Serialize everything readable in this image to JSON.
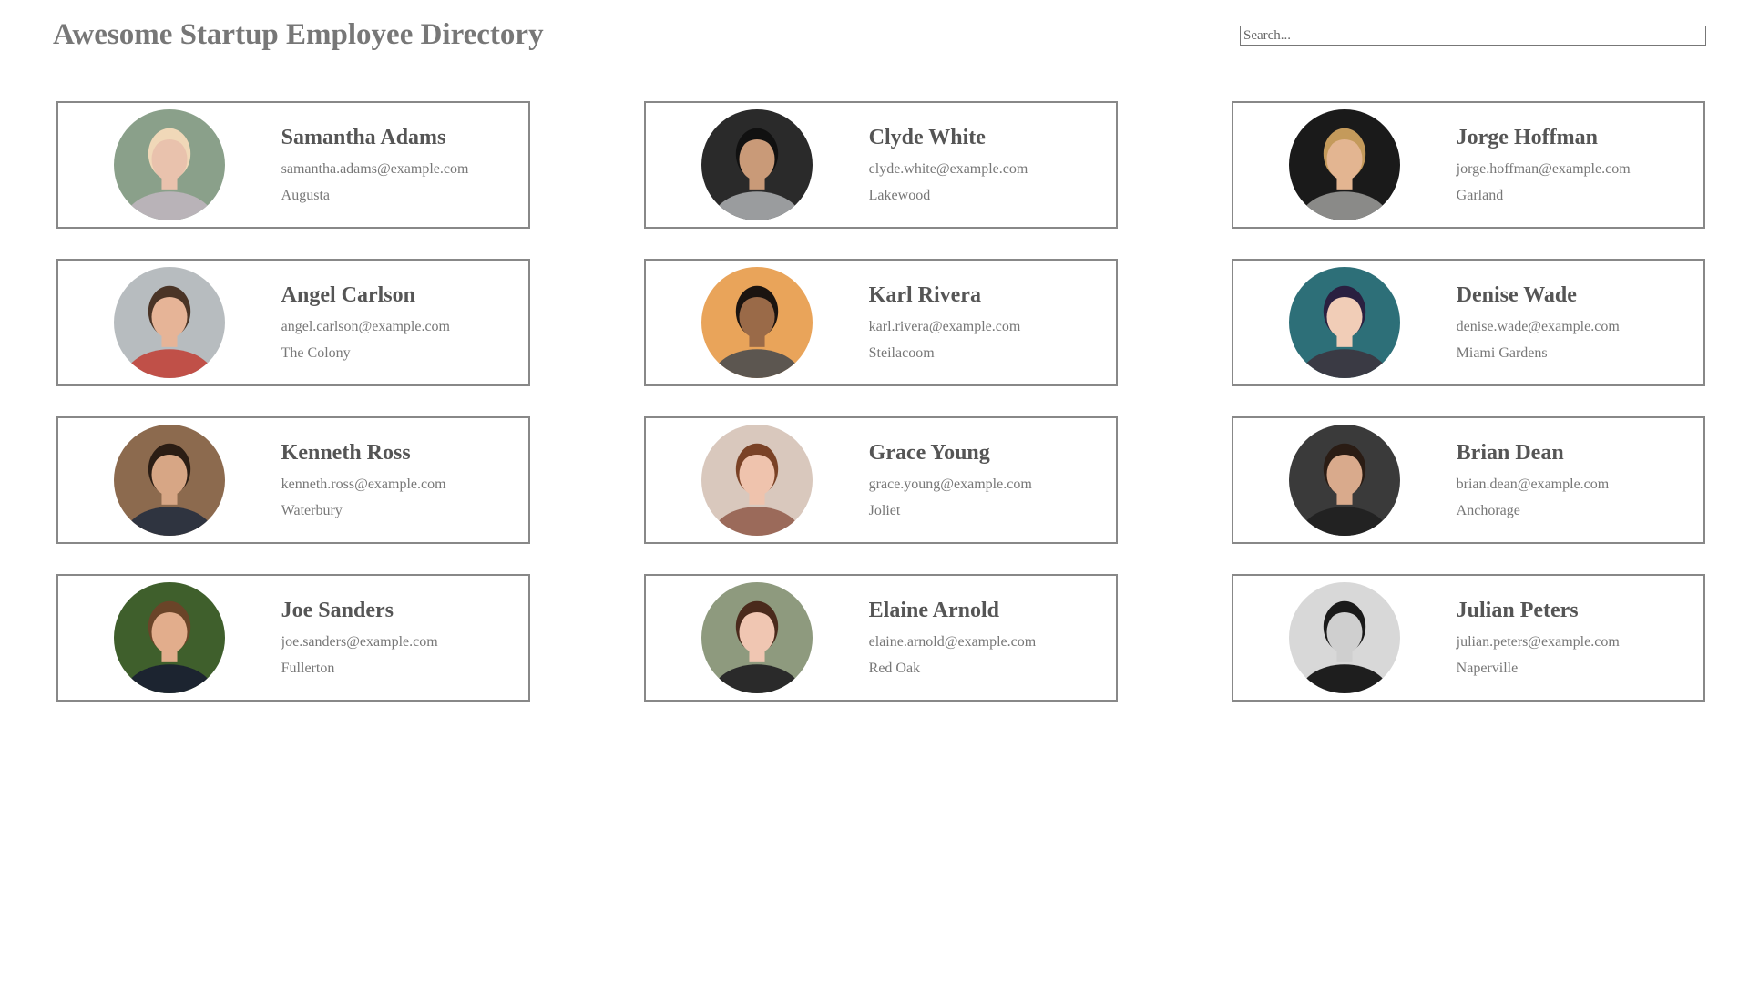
{
  "header": {
    "title": "Awesome Startup Employee Directory",
    "search_placeholder": "Search..."
  },
  "employees": [
    {
      "name": "Samantha Adams",
      "email": "samantha.adams@example.com",
      "city": "Augusta",
      "photo": {
        "bg": "#8aa08a",
        "skin": "#e9c2ad",
        "hair": "#f0d8b8",
        "shirt": "#b9b3b8"
      }
    },
    {
      "name": "Clyde White",
      "email": "clyde.white@example.com",
      "city": "Lakewood",
      "photo": {
        "bg": "#2a2a2a",
        "skin": "#c99a78",
        "hair": "#111111",
        "shirt": "#9a9c9e"
      }
    },
    {
      "name": "Jorge Hoffman",
      "email": "jorge.hoffman@example.com",
      "city": "Garland",
      "photo": {
        "bg": "#1a1a1a",
        "skin": "#e3b591",
        "hair": "#c49a5b",
        "shirt": "#8a8a88"
      }
    },
    {
      "name": "Angel Carlson",
      "email": "angel.carlson@example.com",
      "city": "The Colony",
      "photo": {
        "bg": "#b7bcbf",
        "skin": "#e6b497",
        "hair": "#4a3426",
        "shirt": "#c05048"
      }
    },
    {
      "name": "Karl Rivera",
      "email": "karl.rivera@example.com",
      "city": "Steilacoom",
      "photo": {
        "bg": "#e9a45a",
        "skin": "#9a6a48",
        "hair": "#1b1410",
        "shirt": "#5c5650"
      }
    },
    {
      "name": "Denise Wade",
      "email": "denise.wade@example.com",
      "city": "Miami Gardens",
      "photo": {
        "bg": "#2d6f78",
        "skin": "#f1cdb7",
        "hair": "#2a2040",
        "shirt": "#3a3a44"
      }
    },
    {
      "name": "Kenneth Ross",
      "email": "kenneth.ross@example.com",
      "city": "Waterbury",
      "photo": {
        "bg": "#8c6a4e",
        "skin": "#d7a685",
        "hair": "#2b1d14",
        "shirt": "#2f3440"
      }
    },
    {
      "name": "Grace Young",
      "email": "grace.young@example.com",
      "city": "Joliet",
      "photo": {
        "bg": "#d9c8bd",
        "skin": "#efc3ad",
        "hair": "#7a4226",
        "shirt": "#9b6a5a"
      }
    },
    {
      "name": "Brian Dean",
      "email": "brian.dean@example.com",
      "city": "Anchorage",
      "photo": {
        "bg": "#3a3a3a",
        "skin": "#d9aa8c",
        "hair": "#2a1c14",
        "shirt": "#222222"
      }
    },
    {
      "name": "Joe Sanders",
      "email": "joe.sanders@example.com",
      "city": "Fullerton",
      "photo": {
        "bg": "#3f5f2c",
        "skin": "#e2ad8c",
        "hair": "#6a4428",
        "shirt": "#1c2430"
      }
    },
    {
      "name": "Elaine Arnold",
      "email": "elaine.arnold@example.com",
      "city": "Red Oak",
      "photo": {
        "bg": "#8e9a7e",
        "skin": "#f0c6b2",
        "hair": "#4a2a1c",
        "shirt": "#2a2a2a"
      }
    },
    {
      "name": "Julian Peters",
      "email": "julian.peters@example.com",
      "city": "Naperville",
      "photo": {
        "bg": "#d8d8d8",
        "skin": "#cfcfcf",
        "hair": "#1a1a1a",
        "shirt": "#1e1e1e"
      }
    }
  ]
}
